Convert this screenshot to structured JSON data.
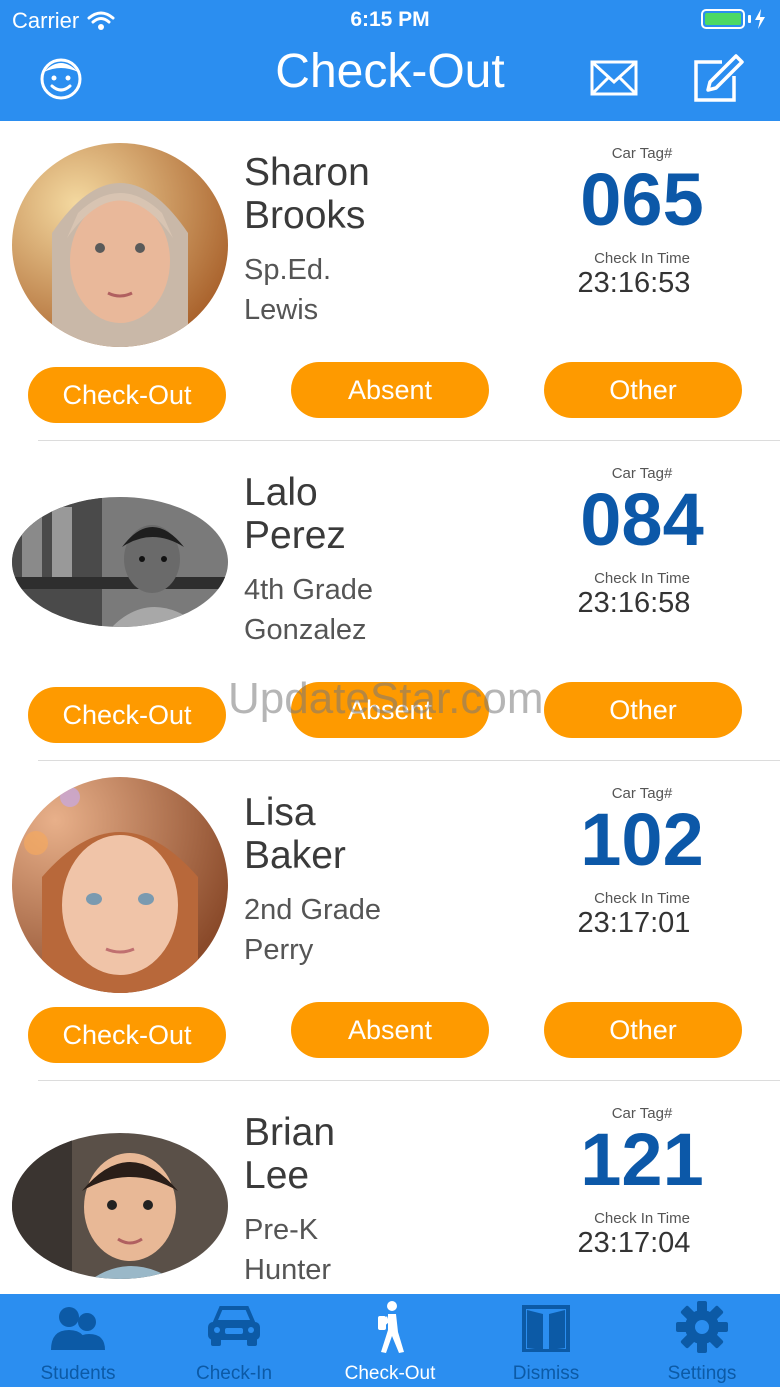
{
  "status": {
    "carrier": "Carrier",
    "time": "6:15 PM"
  },
  "nav": {
    "title": "Check-Out"
  },
  "labels": {
    "car_tag": "Car Tag#",
    "check_in_time": "Check In Time"
  },
  "buttons": {
    "checkout": "Check-Out",
    "absent": "Absent",
    "other": "Other"
  },
  "students": [
    {
      "first": "Sharon",
      "last": "Brooks",
      "grade": "Sp.Ed.",
      "teacher": "Lewis",
      "tag": "065",
      "time": "23:16:53"
    },
    {
      "first": "Lalo",
      "last": "Perez",
      "grade": "4th Grade",
      "teacher": "Gonzalez",
      "tag": "084",
      "time": "23:16:58"
    },
    {
      "first": "Lisa",
      "last": "Baker",
      "grade": "2nd Grade",
      "teacher": "Perry",
      "tag": "102",
      "time": "23:17:01"
    },
    {
      "first": "Brian",
      "last": "Lee",
      "grade": "Pre-K",
      "teacher": "Hunter",
      "tag": "121",
      "time": "23:17:04"
    }
  ],
  "watermark": "UpdateStar.com",
  "tabs": [
    {
      "label": "Students",
      "icon": "students-icon",
      "active": false
    },
    {
      "label": "Check-In",
      "icon": "car-icon",
      "active": false
    },
    {
      "label": "Check-Out",
      "icon": "walking-icon",
      "active": true
    },
    {
      "label": "Dismiss",
      "icon": "door-icon",
      "active": false
    },
    {
      "label": "Settings",
      "icon": "gear-icon",
      "active": false
    }
  ],
  "colors": {
    "header": "#2b8ef0",
    "accent": "#fe9a00",
    "tag": "#0c58a8",
    "tab_inactive": "#0c5aa6"
  }
}
